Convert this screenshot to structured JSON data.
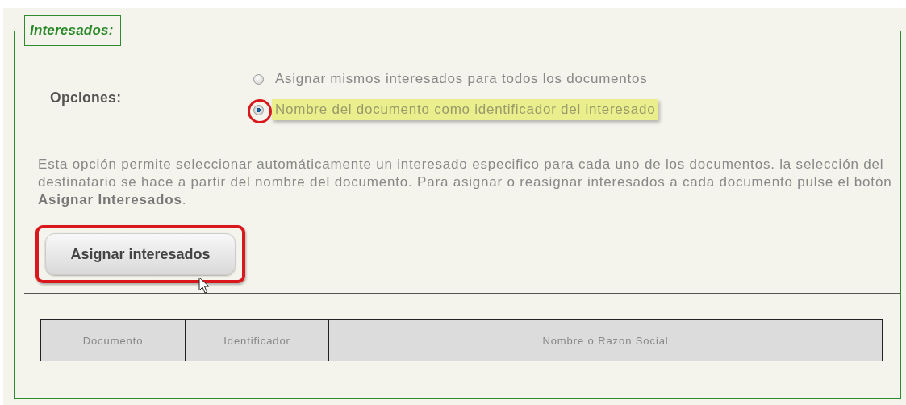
{
  "panel": {
    "legend": "Interesados:"
  },
  "options_label": "Opciones:",
  "options": [
    {
      "label": "Asignar mismos interesados para todos los documentos",
      "selected": false
    },
    {
      "label": "Nombre del documento como identificador del interesado",
      "selected": true
    }
  ],
  "description": "Esta opción permite seleccionar automáticamente un interesado especifico para cada uno de los documentos. la selección del destinatario se hace a partir del nombre del documento. Para asignar o reasignar interesados a cada documento pulse el botón **Asignar Interesados**.",
  "button": {
    "label": "Asignar interesados",
    "highlighted": true
  },
  "table": {
    "columns": [
      "Documento",
      "Identificador",
      "Nombre o Razon Social"
    ]
  }
}
